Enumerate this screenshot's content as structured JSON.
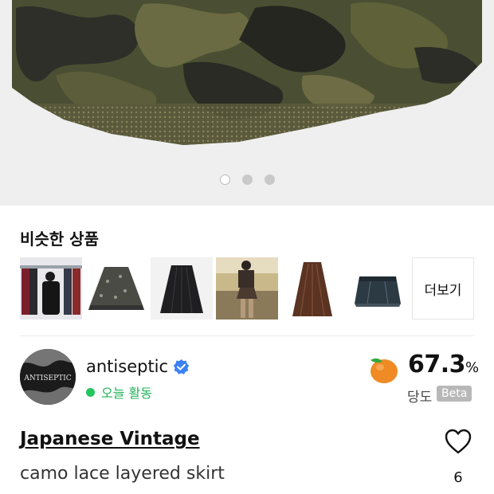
{
  "hero": {
    "image_icon": "camo-lace-skirt-photo",
    "carousel": {
      "count": 3,
      "active_index": 0
    }
  },
  "similar": {
    "title": "비슷한 상품",
    "items": [
      {
        "icon": "store-rack-photo"
      },
      {
        "icon": "floral-skirt-photo"
      },
      {
        "icon": "black-skirt-photo"
      },
      {
        "icon": "model-outfit-photo"
      },
      {
        "icon": "brown-long-skirt-photo"
      },
      {
        "icon": "denim-skirt-photo"
      }
    ],
    "more_label": "더보기"
  },
  "seller": {
    "name": "antiseptic",
    "verified_icon": "verified-check-icon",
    "activity": "오늘 활동",
    "activity_color": "#22c55e",
    "score": "67.3",
    "score_unit": "%",
    "score_label": "당도",
    "beta_label": "Beta",
    "score_icon": "peach-icon"
  },
  "product": {
    "brand": "Japanese Vintage",
    "name": "camo lace layered skirt",
    "likes": "6"
  }
}
